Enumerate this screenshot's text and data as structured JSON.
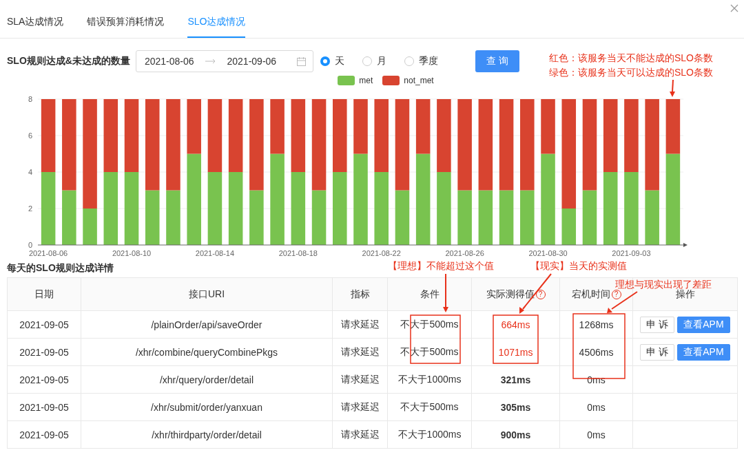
{
  "tabs": [
    {
      "label": "SLA达成情况",
      "selected": false
    },
    {
      "label": "错误预算消耗情况",
      "selected": false
    },
    {
      "label": "SLO达成情况",
      "selected": true
    }
  ],
  "filter": {
    "title": "SLO规则达成&未达成的数量",
    "start_date": "2021-08-06",
    "end_date": "2021-09-06",
    "periods": [
      {
        "label": "天",
        "selected": true
      },
      {
        "label": "月",
        "selected": false
      },
      {
        "label": "季度",
        "selected": false
      }
    ],
    "query_button": "查 询"
  },
  "chart": {
    "chart_data": {
      "type": "bar",
      "stacked": true,
      "grid": true,
      "categories": [
        "2021-08-06",
        null,
        null,
        null,
        "2021-08-10",
        null,
        null,
        null,
        "2021-08-14",
        null,
        null,
        null,
        "2021-08-18",
        null,
        null,
        null,
        "2021-08-22",
        null,
        null,
        null,
        "2021-08-26",
        null,
        null,
        null,
        "2021-08-30",
        null,
        null,
        null,
        "2021-09-03",
        null,
        null
      ],
      "series": [
        {
          "name": "met",
          "color": "#79c34f",
          "values": [
            4,
            3,
            2,
            4,
            4,
            3,
            3,
            5,
            4,
            4,
            3,
            5,
            4,
            3,
            4,
            5,
            4,
            3,
            5,
            4,
            3,
            3,
            3,
            3,
            5,
            2,
            3,
            4,
            4,
            3,
            5
          ]
        },
        {
          "name": "not_met",
          "color": "#d84430",
          "values": [
            4,
            5,
            6,
            4,
            4,
            5,
            5,
            3,
            4,
            4,
            5,
            3,
            4,
            5,
            4,
            3,
            4,
            5,
            3,
            4,
            5,
            5,
            5,
            5,
            3,
            6,
            5,
            4,
            4,
            5,
            3
          ]
        }
      ],
      "ylim": [
        0,
        8
      ],
      "yticks": [
        0,
        2,
        4,
        6,
        8
      ]
    }
  },
  "table": {
    "title": "每天的SLO规则达成详情",
    "columns": [
      {
        "label": "日期"
      },
      {
        "label": "接口URI"
      },
      {
        "label": "指标"
      },
      {
        "label": "条件"
      },
      {
        "label": "实际测得值",
        "help": "?"
      },
      {
        "label": "宕机时间",
        "help": "?"
      },
      {
        "label": "操作"
      }
    ],
    "rows": [
      {
        "date": "2021-09-05",
        "uri": "/plainOrder/api/saveOrder",
        "metric": "请求延迟",
        "condition": "不大于500ms",
        "measured": "664ms",
        "exceeded": true,
        "downtime": "1268ms",
        "actions": [
          {
            "label": "申 诉",
            "kind": "default"
          },
          {
            "label": "查看APM",
            "kind": "primary"
          }
        ]
      },
      {
        "date": "2021-09-05",
        "uri": "/xhr/combine/queryCombinePkgs",
        "metric": "请求延迟",
        "condition": "不大于500ms",
        "measured": "1071ms",
        "exceeded": true,
        "downtime": "4506ms",
        "actions": [
          {
            "label": "申 诉",
            "kind": "default"
          },
          {
            "label": "查看APM",
            "kind": "primary"
          }
        ]
      },
      {
        "date": "2021-09-05",
        "uri": "/xhr/query/order/detail",
        "metric": "请求延迟",
        "condition": "不大于1000ms",
        "measured": "321ms",
        "exceeded": false,
        "downtime": "0ms",
        "actions": []
      },
      {
        "date": "2021-09-05",
        "uri": "/xhr/submit/order/yanxuan",
        "metric": "请求延迟",
        "condition": "不大于500ms",
        "measured": "305ms",
        "exceeded": false,
        "downtime": "0ms",
        "actions": []
      },
      {
        "date": "2021-09-05",
        "uri": "/xhr/thirdparty/order/detail",
        "metric": "请求延迟",
        "condition": "不大于1000ms",
        "measured": "900ms",
        "exceeded": false,
        "downtime": "0ms",
        "actions": []
      }
    ]
  },
  "annotations": [
    "红色：该服务当天不能达成的SLO条数",
    "绿色：该服务当天可以达成的SLO条数",
    "【理想】不能超过这个值",
    "【现实】当天的实测值",
    "理想与现实出现了差距"
  ]
}
